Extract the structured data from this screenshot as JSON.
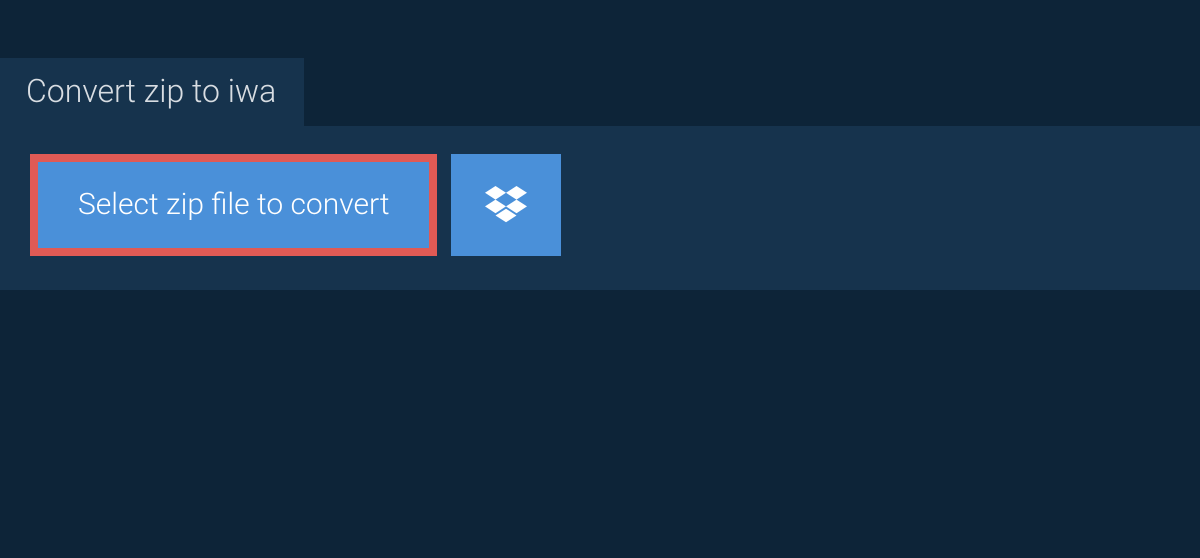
{
  "tab": {
    "title": "Convert zip to iwa"
  },
  "actions": {
    "select_file_label": "Select zip file to convert",
    "dropbox_icon": "dropbox-icon"
  },
  "colors": {
    "background": "#0d2438",
    "panel": "#16334d",
    "button": "#4a90d9",
    "highlight_border": "#e05a55",
    "text_light": "#d8dde2",
    "text_white": "#ffffff"
  }
}
